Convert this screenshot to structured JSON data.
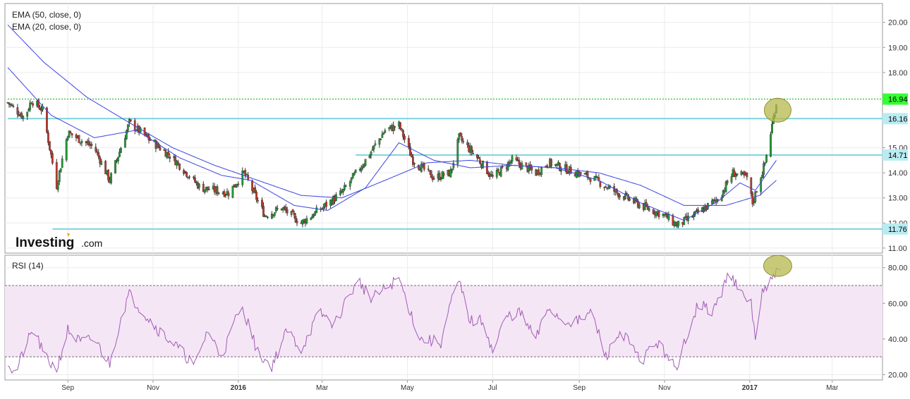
{
  "chart_data": [
    {
      "type": "candlestick",
      "title": "",
      "indicators": [
        "EMA (50, close, 0)",
        "EMA (20, close, 0)"
      ],
      "ylim": [
        10.8,
        20.75
      ],
      "yticks": [
        "20.00",
        "19.00",
        "18.00",
        "15.00",
        "14.00",
        "13.00",
        "12.00",
        "11.00"
      ],
      "xtick_labels": [
        {
          "x": "2015-09-01",
          "label": "Sep",
          "bold": false
        },
        {
          "x": "2015-11-01",
          "label": "Nov",
          "bold": false
        },
        {
          "x": "2016-01-01",
          "label": "2016",
          "bold": true
        },
        {
          "x": "2016-03-01",
          "label": "Mar",
          "bold": false
        },
        {
          "x": "2016-05-01",
          "label": "May",
          "bold": false
        },
        {
          "x": "2016-07-01",
          "label": "Jul",
          "bold": false
        },
        {
          "x": "2016-09-01",
          "label": "Sep",
          "bold": false
        },
        {
          "x": "2016-11-01",
          "label": "Nov",
          "bold": false
        },
        {
          "x": "2017-01-01",
          "label": "2017",
          "bold": true
        },
        {
          "x": "2017-03-01",
          "label": "Mar",
          "bold": false
        }
      ],
      "price_anchors": [
        [
          "2015-07-20",
          16.8
        ],
        [
          "2015-08-01",
          16.2
        ],
        [
          "2015-08-06",
          16.9
        ],
        [
          "2015-08-14",
          16.5
        ],
        [
          "2015-08-24",
          13.5
        ],
        [
          "2015-09-01",
          15.6
        ],
        [
          "2015-09-20",
          15.0
        ],
        [
          "2015-10-01",
          13.7
        ],
        [
          "2015-10-15",
          16.0
        ],
        [
          "2015-10-30",
          15.3
        ],
        [
          "2015-11-15",
          14.6
        ],
        [
          "2015-12-05",
          13.4
        ],
        [
          "2015-12-25",
          13.2
        ],
        [
          "2016-01-05",
          14.0
        ],
        [
          "2016-01-20",
          12.3
        ],
        [
          "2016-02-01",
          12.6
        ],
        [
          "2016-02-15",
          12.0
        ],
        [
          "2016-03-01",
          12.6
        ],
        [
          "2016-03-15",
          13.2
        ],
        [
          "2016-04-01",
          14.5
        ],
        [
          "2016-04-15",
          15.7
        ],
        [
          "2016-04-25",
          15.9
        ],
        [
          "2016-05-05",
          14.5
        ],
        [
          "2016-05-20",
          13.8
        ],
        [
          "2016-06-01",
          14.0
        ],
        [
          "2016-06-07",
          15.4
        ],
        [
          "2016-06-20",
          14.6
        ],
        [
          "2016-07-01",
          13.8
        ],
        [
          "2016-07-15",
          14.5
        ],
        [
          "2016-08-01",
          14.0
        ],
        [
          "2016-08-10",
          14.4
        ],
        [
          "2016-08-25",
          14.1
        ],
        [
          "2016-09-10",
          13.8
        ],
        [
          "2016-09-25",
          13.3
        ],
        [
          "2016-10-15",
          12.7
        ],
        [
          "2016-11-01",
          12.3
        ],
        [
          "2016-11-10",
          11.9
        ],
        [
          "2016-11-25",
          12.4
        ],
        [
          "2016-12-10",
          13.0
        ],
        [
          "2016-12-20",
          14.0
        ],
        [
          "2016-12-30",
          13.8
        ],
        [
          "2017-01-03",
          12.8
        ],
        [
          "2017-01-08",
          13.7
        ],
        [
          "2017-01-12",
          14.4
        ],
        [
          "2017-01-16",
          15.6
        ],
        [
          "2017-01-20",
          16.8
        ]
      ],
      "ema50_anchors": [
        [
          "2015-07-20",
          19.9
        ],
        [
          "2015-08-15",
          18.4
        ],
        [
          "2015-09-15",
          17.0
        ],
        [
          "2015-10-15",
          16.0
        ],
        [
          "2015-11-15",
          15.0
        ],
        [
          "2015-12-15",
          14.3
        ],
        [
          "2016-01-15",
          13.7
        ],
        [
          "2016-02-15",
          13.1
        ],
        [
          "2016-03-15",
          13.0
        ],
        [
          "2016-04-15",
          13.7
        ],
        [
          "2016-05-15",
          14.4
        ],
        [
          "2016-06-15",
          14.5
        ],
        [
          "2016-07-15",
          14.3
        ],
        [
          "2016-08-15",
          14.2
        ],
        [
          "2016-09-15",
          14.0
        ],
        [
          "2016-10-15",
          13.5
        ],
        [
          "2016-11-15",
          12.7
        ],
        [
          "2016-12-15",
          12.7
        ],
        [
          "2017-01-08",
          13.1
        ],
        [
          "2017-01-20",
          13.7
        ]
      ],
      "ema20_anchors": [
        [
          "2015-07-20",
          18.2
        ],
        [
          "2015-08-20",
          16.3
        ],
        [
          "2015-09-20",
          15.4
        ],
        [
          "2015-10-20",
          15.7
        ],
        [
          "2015-11-20",
          14.6
        ],
        [
          "2015-12-20",
          13.9
        ],
        [
          "2016-01-10",
          13.7
        ],
        [
          "2016-02-10",
          12.7
        ],
        [
          "2016-03-05",
          12.5
        ],
        [
          "2016-04-01",
          13.4
        ],
        [
          "2016-04-25",
          15.2
        ],
        [
          "2016-05-20",
          14.5
        ],
        [
          "2016-06-15",
          14.2
        ],
        [
          "2016-07-15",
          14.3
        ],
        [
          "2016-08-15",
          14.2
        ],
        [
          "2016-09-15",
          13.7
        ],
        [
          "2016-10-15",
          12.8
        ],
        [
          "2016-11-15",
          12.1
        ],
        [
          "2016-12-10",
          12.9
        ],
        [
          "2016-12-25",
          13.6
        ],
        [
          "2017-01-05",
          13.3
        ],
        [
          "2017-01-20",
          14.5
        ]
      ],
      "horizontal_levels": [
        {
          "value": 16.94,
          "label": "16.94",
          "style": "dotted",
          "color": "#00b300",
          "badge": "#33ff33",
          "x_from": "2015-07-20"
        },
        {
          "value": 16.16,
          "label": "16.16",
          "style": "solid",
          "color": "#7fd3dc",
          "badge": "#b8ecf2",
          "x_from": "2015-07-20"
        },
        {
          "value": 14.71,
          "label": "14.71",
          "style": "solid",
          "color": "#7fd3dc",
          "badge": "#b8ecf2",
          "x_from": "2016-03-25"
        },
        {
          "value": 11.76,
          "label": "11.76",
          "style": "solid",
          "color": "#7fd3dc",
          "badge": "#b8ecf2",
          "x_from": "2015-08-21"
        }
      ],
      "highlight": {
        "x": "2017-01-21",
        "y": 16.5
      }
    },
    {
      "type": "line",
      "title": "RSI (14)",
      "ylim": [
        17,
        87
      ],
      "yticks": [
        "80.00",
        "60.00",
        "40.00",
        "20.00"
      ],
      "overbought": 70,
      "oversold": 30,
      "series": [
        {
          "values_anchors": [
            [
              "2015-07-20",
              28
            ],
            [
              "2015-07-25",
              19
            ],
            [
              "2015-08-01",
              35
            ],
            [
              "2015-08-08",
              46
            ],
            [
              "2015-08-15",
              30
            ],
            [
              "2015-08-24",
              23
            ],
            [
              "2015-09-01",
              45
            ],
            [
              "2015-09-10",
              38
            ],
            [
              "2015-09-20",
              40
            ],
            [
              "2015-10-01",
              26
            ],
            [
              "2015-10-10",
              55
            ],
            [
              "2015-10-15",
              65
            ],
            [
              "2015-10-25",
              55
            ],
            [
              "2015-11-05",
              45
            ],
            [
              "2015-11-15",
              38
            ],
            [
              "2015-12-01",
              25
            ],
            [
              "2015-12-10",
              45
            ],
            [
              "2015-12-20",
              30
            ],
            [
              "2016-01-01",
              55
            ],
            [
              "2016-01-05",
              56
            ],
            [
              "2016-01-15",
              32
            ],
            [
              "2016-01-25",
              25
            ],
            [
              "2016-02-05",
              45
            ],
            [
              "2016-02-15",
              34
            ],
            [
              "2016-02-28",
              55
            ],
            [
              "2016-03-10",
              48
            ],
            [
              "2016-03-20",
              65
            ],
            [
              "2016-03-28",
              72
            ],
            [
              "2016-04-05",
              62
            ],
            [
              "2016-04-15",
              68
            ],
            [
              "2016-04-25",
              74
            ],
            [
              "2016-05-01",
              60
            ],
            [
              "2016-05-10",
              40
            ],
            [
              "2016-05-25",
              38
            ],
            [
              "2016-06-01",
              60
            ],
            [
              "2016-06-07",
              72
            ],
            [
              "2016-06-15",
              50
            ],
            [
              "2016-06-25",
              50
            ],
            [
              "2016-07-01",
              32
            ],
            [
              "2016-07-10",
              52
            ],
            [
              "2016-07-20",
              55
            ],
            [
              "2016-08-01",
              40
            ],
            [
              "2016-08-10",
              58
            ],
            [
              "2016-08-20",
              50
            ],
            [
              "2016-09-01",
              50
            ],
            [
              "2016-09-10",
              55
            ],
            [
              "2016-09-20",
              30
            ],
            [
              "2016-10-01",
              45
            ],
            [
              "2016-10-15",
              27
            ],
            [
              "2016-10-25",
              38
            ],
            [
              "2016-11-05",
              30
            ],
            [
              "2016-11-10",
              20
            ],
            [
              "2016-11-15",
              38
            ],
            [
              "2016-11-25",
              60
            ],
            [
              "2016-12-05",
              55
            ],
            [
              "2016-12-12",
              65
            ],
            [
              "2016-12-17",
              80
            ],
            [
              "2016-12-25",
              65
            ],
            [
              "2017-01-02",
              60
            ],
            [
              "2017-01-05",
              40
            ],
            [
              "2017-01-10",
              66
            ],
            [
              "2017-01-14",
              68
            ],
            [
              "2017-01-18",
              75
            ],
            [
              "2017-01-23",
              82
            ]
          ]
        }
      ],
      "highlight": {
        "x": "2017-01-21",
        "y": 81
      }
    }
  ],
  "logo": {
    "brand": "Investing",
    "suffix": ".com"
  },
  "colors": {
    "up": "#1e9c33",
    "down": "#c0392b",
    "ema": "#3b45e0",
    "rsi": "#a05cb4",
    "rsi_band": "#f5e6f6",
    "highlight_fill": "#b5b84d",
    "highlight_stroke": "#8f9231"
  }
}
